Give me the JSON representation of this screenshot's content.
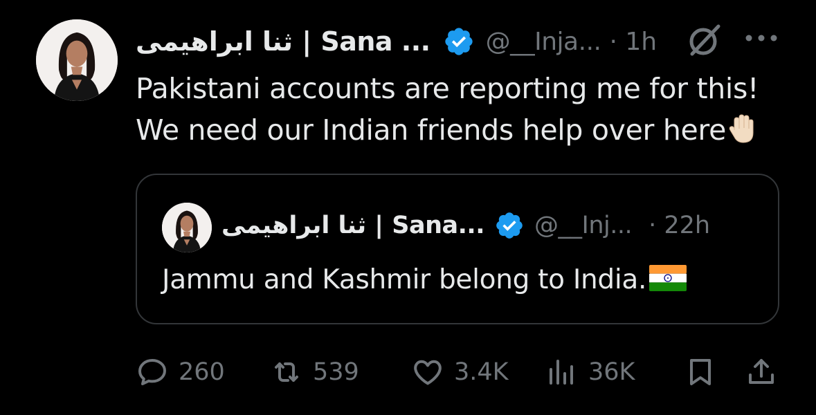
{
  "post": {
    "author_name": "ثنا ابراهیمی | Sana ...",
    "handle": "@__Inja...",
    "time": "· 1h",
    "text_lines": [
      "Pakistani accounts are reporting me for this!",
      "We need our Indian friends help over here"
    ],
    "text_emoji": "raised-hand-emoji"
  },
  "quoted": {
    "author_name": "ثنا ابراهیمی | Sana...",
    "handle": "@__Inj...",
    "time": "· 22h",
    "text": "Jammu and Kashmir belong to India.",
    "text_emoji": "india-flag-emoji"
  },
  "actions": {
    "replies": "260",
    "reposts": "539",
    "likes": "3.4K",
    "views": "36K"
  },
  "colors": {
    "background": "#000000",
    "primary_text": "#e7e9ea",
    "secondary_text": "#71767b",
    "verified_badge": "#1d9bf0",
    "border": "#333639"
  }
}
